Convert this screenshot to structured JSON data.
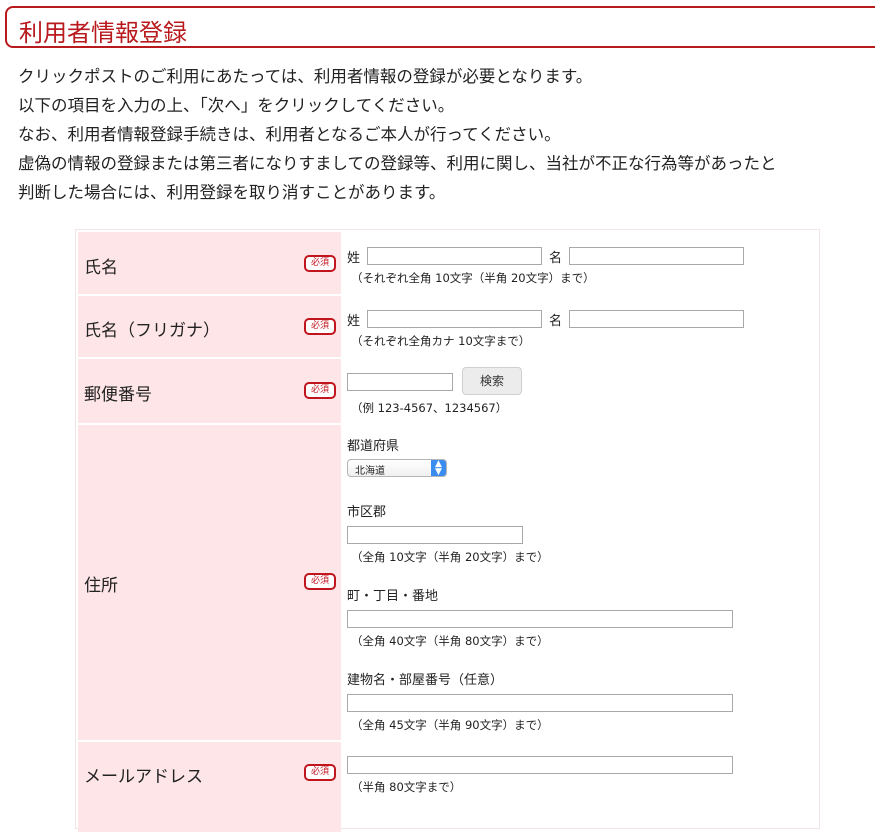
{
  "header": {
    "title": "利用者情報登録"
  },
  "intro": [
    "クリックポストのご利用にあたっては、利用者情報の登録が必要となります。",
    "以下の項目を入力の上、「次へ」をクリックしてください。",
    "なお、利用者情報登録手続きは、利用者となるご本人が行ってください。",
    "虚偽の情報の登録または第三者になりすましての登録等、利用に関し、当社が不正な行為等があったと",
    "判断した場合には、利用登録を取り消すことがあります。"
  ],
  "required_badge": "必須",
  "rows": {
    "name": {
      "label": "氏名",
      "sei_label": "姓",
      "mei_label": "名",
      "sei_value": "",
      "mei_value": "",
      "hint": "（それぞれ全角 10文字（半角 20文字）まで）"
    },
    "furigana": {
      "label": "氏名（フリガナ）",
      "sei_label": "姓",
      "mei_label": "名",
      "sei_value": "",
      "mei_value": "",
      "hint": "（それぞれ全角カナ 10文字まで）"
    },
    "postal": {
      "label": "郵便番号",
      "value": "",
      "search_button": "検索",
      "hint": "（例 123-4567、1234567）"
    },
    "address": {
      "label": "住所",
      "prefecture_label": "都道府県",
      "prefecture_selected": "北海道",
      "city_label": "市区郡",
      "city_value": "",
      "city_hint": "（全角 10文字（半角 20文字）まで）",
      "street_label": "町・丁目・番地",
      "street_value": "",
      "street_hint": "（全角 40文字（半角 80文字）まで）",
      "building_label": "建物名・部屋番号（任意）",
      "building_value": "",
      "building_hint": "（全角 45文字（半角 90文字）まで）"
    },
    "email": {
      "label": "メールアドレス",
      "value": "",
      "hint": "（半角 80文字まで）"
    }
  }
}
